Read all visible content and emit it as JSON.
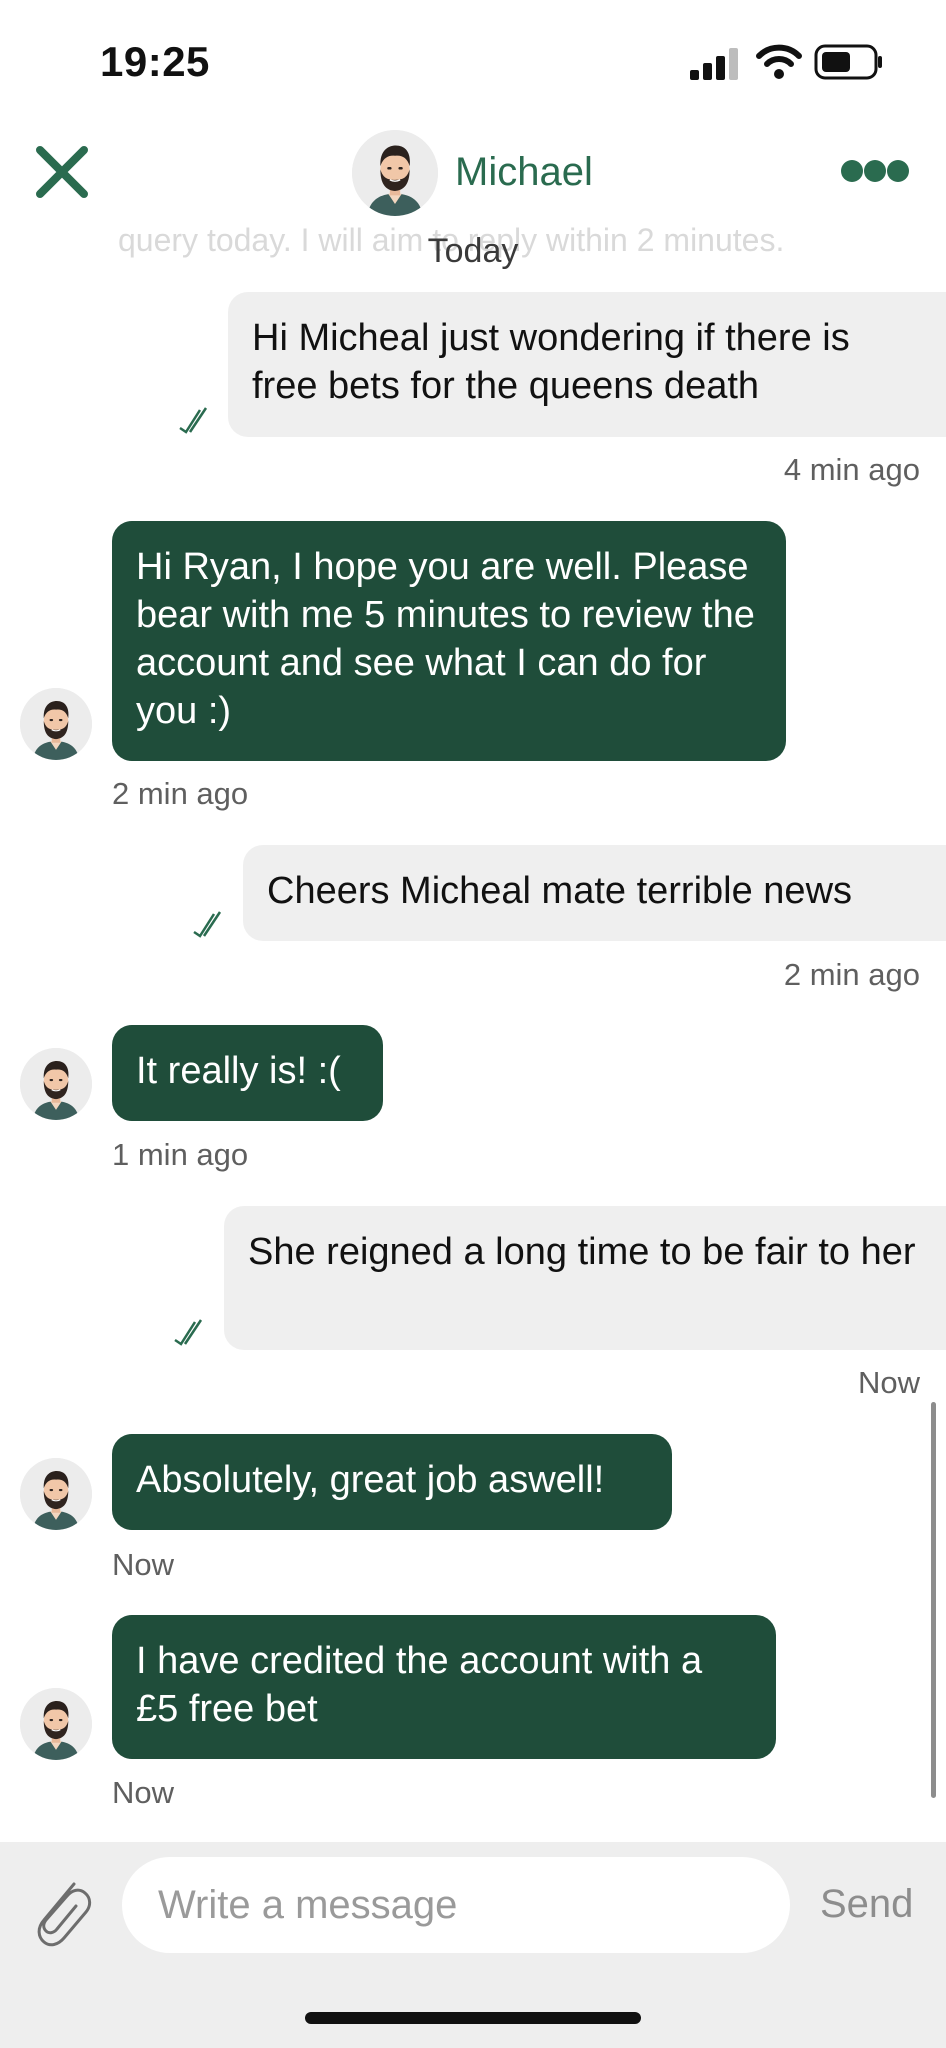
{
  "status_bar": {
    "time": "19:25"
  },
  "header": {
    "agent_name": "Michael"
  },
  "chat": {
    "faded_previous_text": "query today. I will aim to reply within 2 minutes.",
    "day_label": "Today",
    "messages": [
      {
        "direction": "out",
        "text": "Hi Micheal just wondering if there is free bets for the queens death",
        "time": "4 min ago"
      },
      {
        "direction": "in",
        "text": "Hi Ryan, I hope you are well. Please bear with me 5 minutes to review the account and see what I can do for you :)",
        "time": "2 min ago"
      },
      {
        "direction": "out",
        "text": "Cheers Micheal mate terrible news",
        "time": "2 min ago"
      },
      {
        "direction": "in",
        "text": "It really is! :(",
        "time": "1 min ago"
      },
      {
        "direction": "out",
        "text": "She reigned a long time to be fair to her",
        "time": "Now"
      },
      {
        "direction": "in",
        "text": "Absolutely, great job aswell!",
        "time": "Now"
      },
      {
        "direction": "in",
        "text": "I have credited the account with a £5 free bet",
        "time": "Now"
      }
    ]
  },
  "composer": {
    "placeholder": "Write a message",
    "send_label": "Send"
  },
  "colors": {
    "brand_green": "#1f4d3a",
    "accent_green": "#2a6b4f",
    "outgoing_bubble": "#efefef"
  },
  "icons": {
    "close": "close-icon",
    "more": "more-icon",
    "attach": "paperclip-icon",
    "read_receipt": "double-check-icon"
  }
}
